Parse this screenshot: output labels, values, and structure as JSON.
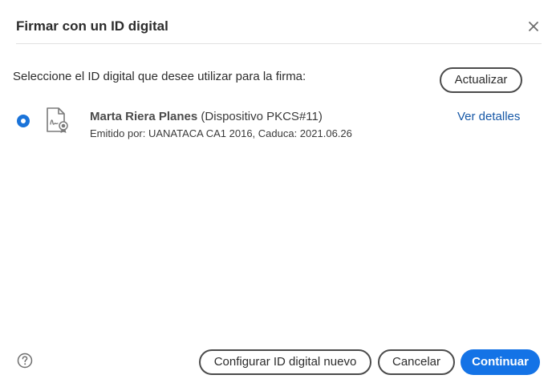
{
  "dialog": {
    "title": "Firmar con un ID digital",
    "close_icon": "close-icon"
  },
  "content": {
    "prompt": "Seleccione el ID digital que desee utilizar para la firma:",
    "refresh_label": "Actualizar",
    "digital_ids": [
      {
        "selected": true,
        "icon": "certificate-icon",
        "name": "Marta Riera Planes",
        "device": "(Dispositivo PKCS#11)",
        "meta": "Emitido por: UANATACA CA1 2016, Caduca: 2021.06.26",
        "details_label": "Ver detalles"
      }
    ]
  },
  "footer": {
    "help_icon": "help-icon",
    "setup_label": "Configurar ID digital nuevo",
    "cancel_label": "Cancelar",
    "continue_label": "Continuar"
  },
  "colors": {
    "accent": "#1473e6",
    "radio": "#1a73d9",
    "link": "#1557a6",
    "divider": "#e1e1e1",
    "pill_border": "#4b4b4b"
  }
}
